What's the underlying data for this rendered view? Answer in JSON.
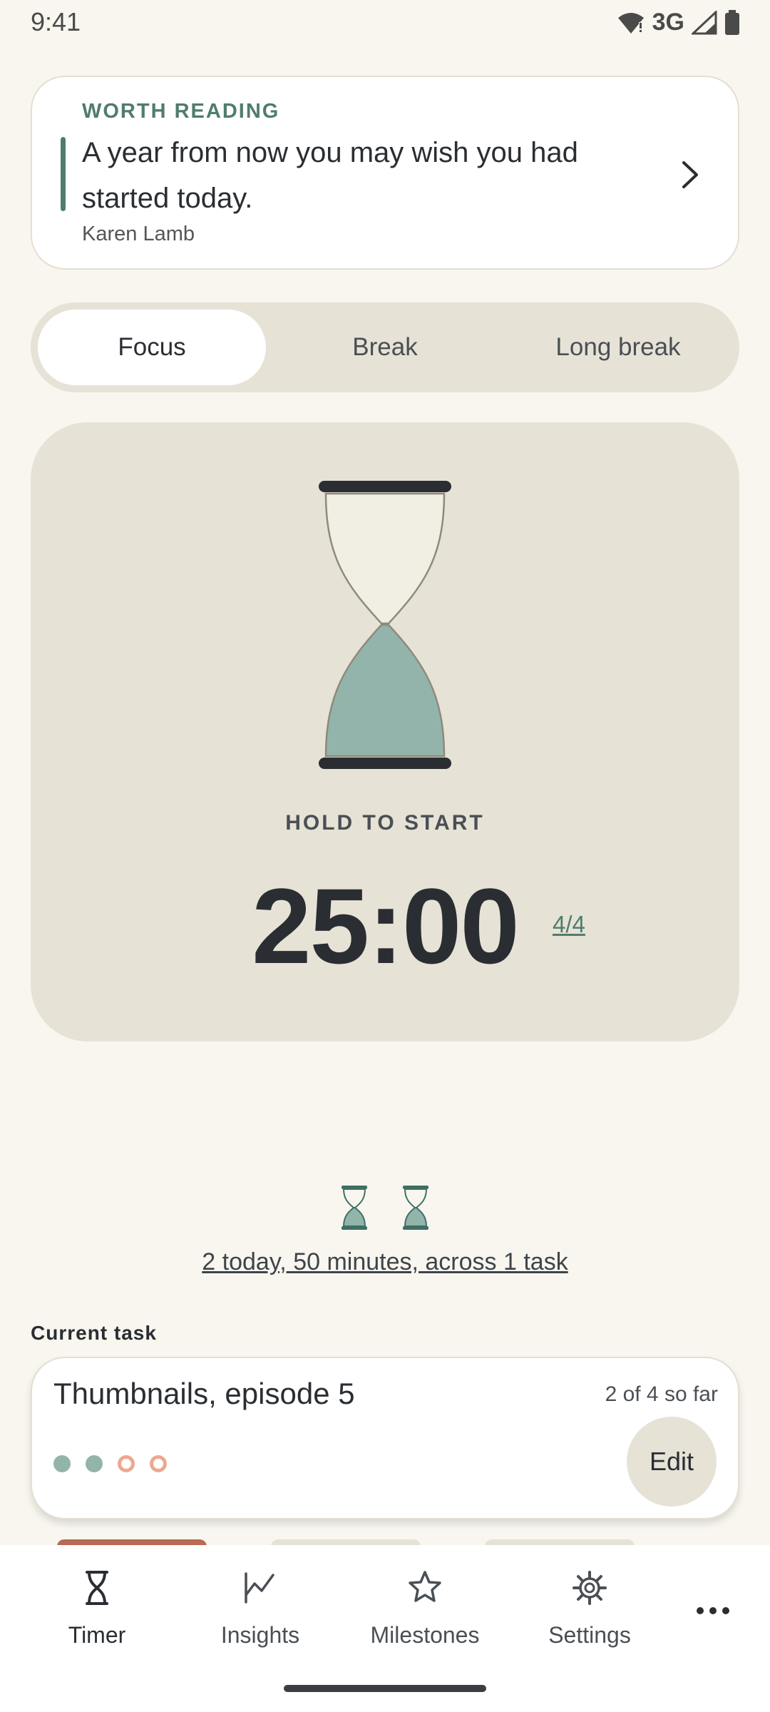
{
  "status_bar": {
    "time": "9:41",
    "network": "3G"
  },
  "quote": {
    "kicker": "WORTH READING",
    "text": "A year from now you may wish you had started today.",
    "author": "Karen Lamb"
  },
  "modes": {
    "tabs": [
      "Focus",
      "Break",
      "Long break"
    ],
    "selected": "Focus"
  },
  "timer": {
    "hold_label": "HOLD TO START",
    "time": "25:00",
    "session_count": "4/4"
  },
  "today": {
    "summary": "2 today, 50 minutes, across 1 task",
    "completed_sessions": 2
  },
  "current_task": {
    "heading": "Current task",
    "title": "Thumbnails, episode 5",
    "progress": "2 of 4 so far",
    "sessions_done": 2,
    "sessions_total": 4,
    "edit_label": "Edit"
  },
  "nav": {
    "items": [
      {
        "label": "Timer",
        "icon": "hourglass-icon"
      },
      {
        "label": "Insights",
        "icon": "line-chart-icon"
      },
      {
        "label": "Milestones",
        "icon": "star-icon"
      },
      {
        "label": "Settings",
        "icon": "gear-icon"
      }
    ],
    "more_icon": "more-horizontal-icon",
    "active": "Timer"
  },
  "colors": {
    "background": "#F8F6EF",
    "card": "#E6E2D5",
    "accent": "#4F7C70",
    "sand": "#93B4AA",
    "todo_dot": "#EDA892"
  }
}
